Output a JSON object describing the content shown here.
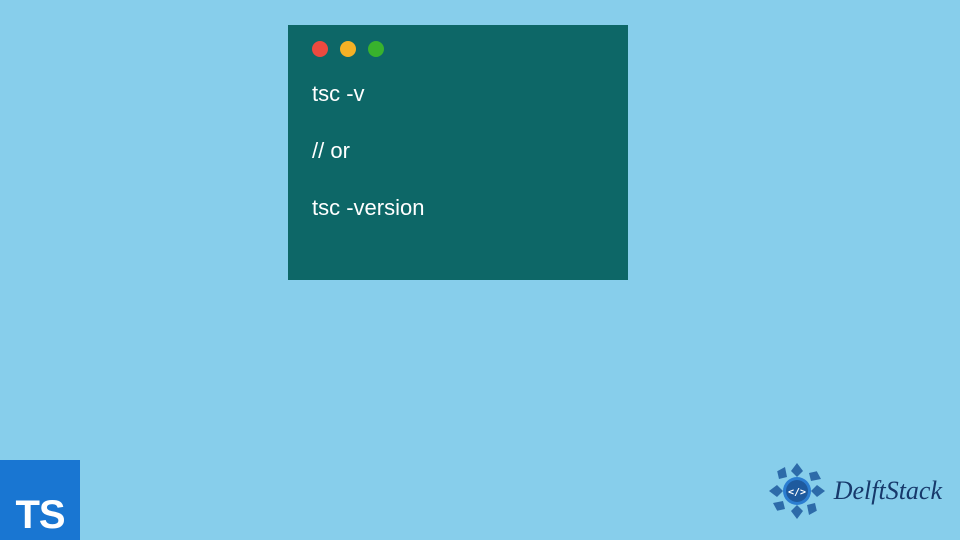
{
  "terminal": {
    "lines": [
      "tsc -v",
      "// or",
      "tsc -version"
    ]
  },
  "ts_badge": {
    "label": "TS"
  },
  "brand": {
    "name": "DelftStack"
  },
  "colors": {
    "background": "#87ceeb",
    "terminal_bg": "#0d6767",
    "ts_badge_bg": "#1976d2",
    "brand_text": "#17396b"
  }
}
